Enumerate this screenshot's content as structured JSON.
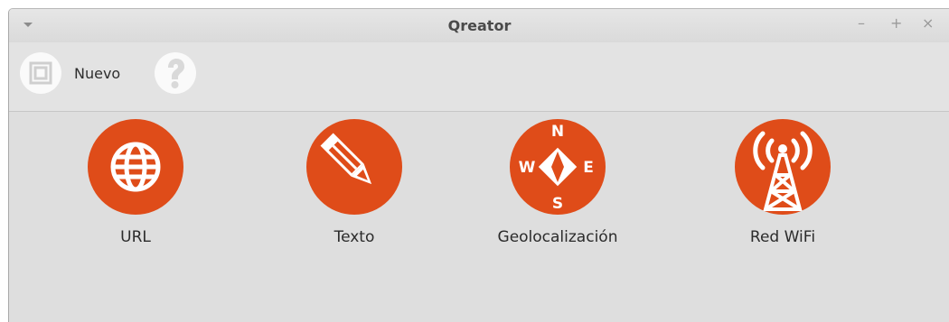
{
  "window": {
    "title": "Qreator"
  },
  "toolbar": {
    "new_label": "Nuevo",
    "help_icon": "question-icon",
    "new_icon": "new-document-icon"
  },
  "window_controls": {
    "minimize": "–",
    "maximize": "+",
    "close": "×"
  },
  "items": [
    {
      "label": "URL",
      "icon": "globe-icon"
    },
    {
      "label": "Texto",
      "icon": "pencil-icon"
    },
    {
      "label": "Geolocalización",
      "icon": "compass-icon",
      "compass_letters": [
        "N",
        "W",
        "E",
        "S"
      ]
    },
    {
      "label": "Red WiFi",
      "icon": "wifi-tower-icon"
    }
  ],
  "colors": {
    "accent": "#df4c19",
    "background": "#dedede"
  }
}
